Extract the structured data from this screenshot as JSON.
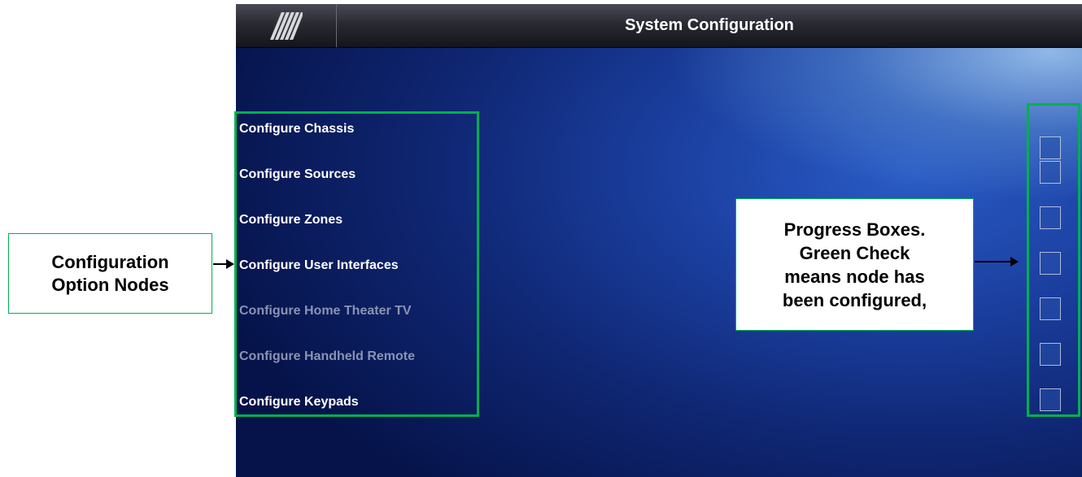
{
  "header": {
    "title": "System Configuration",
    "logo_icon": "stripes-logo-icon"
  },
  "nodes": [
    {
      "label": "Configure Chassis",
      "enabled": true
    },
    {
      "label": "Configure Sources",
      "enabled": true
    },
    {
      "label": "Configure Zones",
      "enabled": true
    },
    {
      "label": "Configure User Interfaces",
      "enabled": true
    },
    {
      "label": "Configure Home Theater TV",
      "enabled": false
    },
    {
      "label": "Configure Handheld Remote",
      "enabled": false
    },
    {
      "label": "Configure Keypads",
      "enabled": true
    }
  ],
  "progress_boxes": [
    {
      "checked": false
    },
    {
      "checked": false
    },
    {
      "checked": false
    },
    {
      "checked": false
    },
    {
      "checked": false
    },
    {
      "checked": false
    },
    {
      "checked": false
    }
  ],
  "annotations": {
    "left_callout": "Configuration\nOption Nodes",
    "right_callout": "Progress Boxes.\nGreen Check\nmeans node has\nbeen configured,",
    "highlight_color": "#00b050"
  }
}
